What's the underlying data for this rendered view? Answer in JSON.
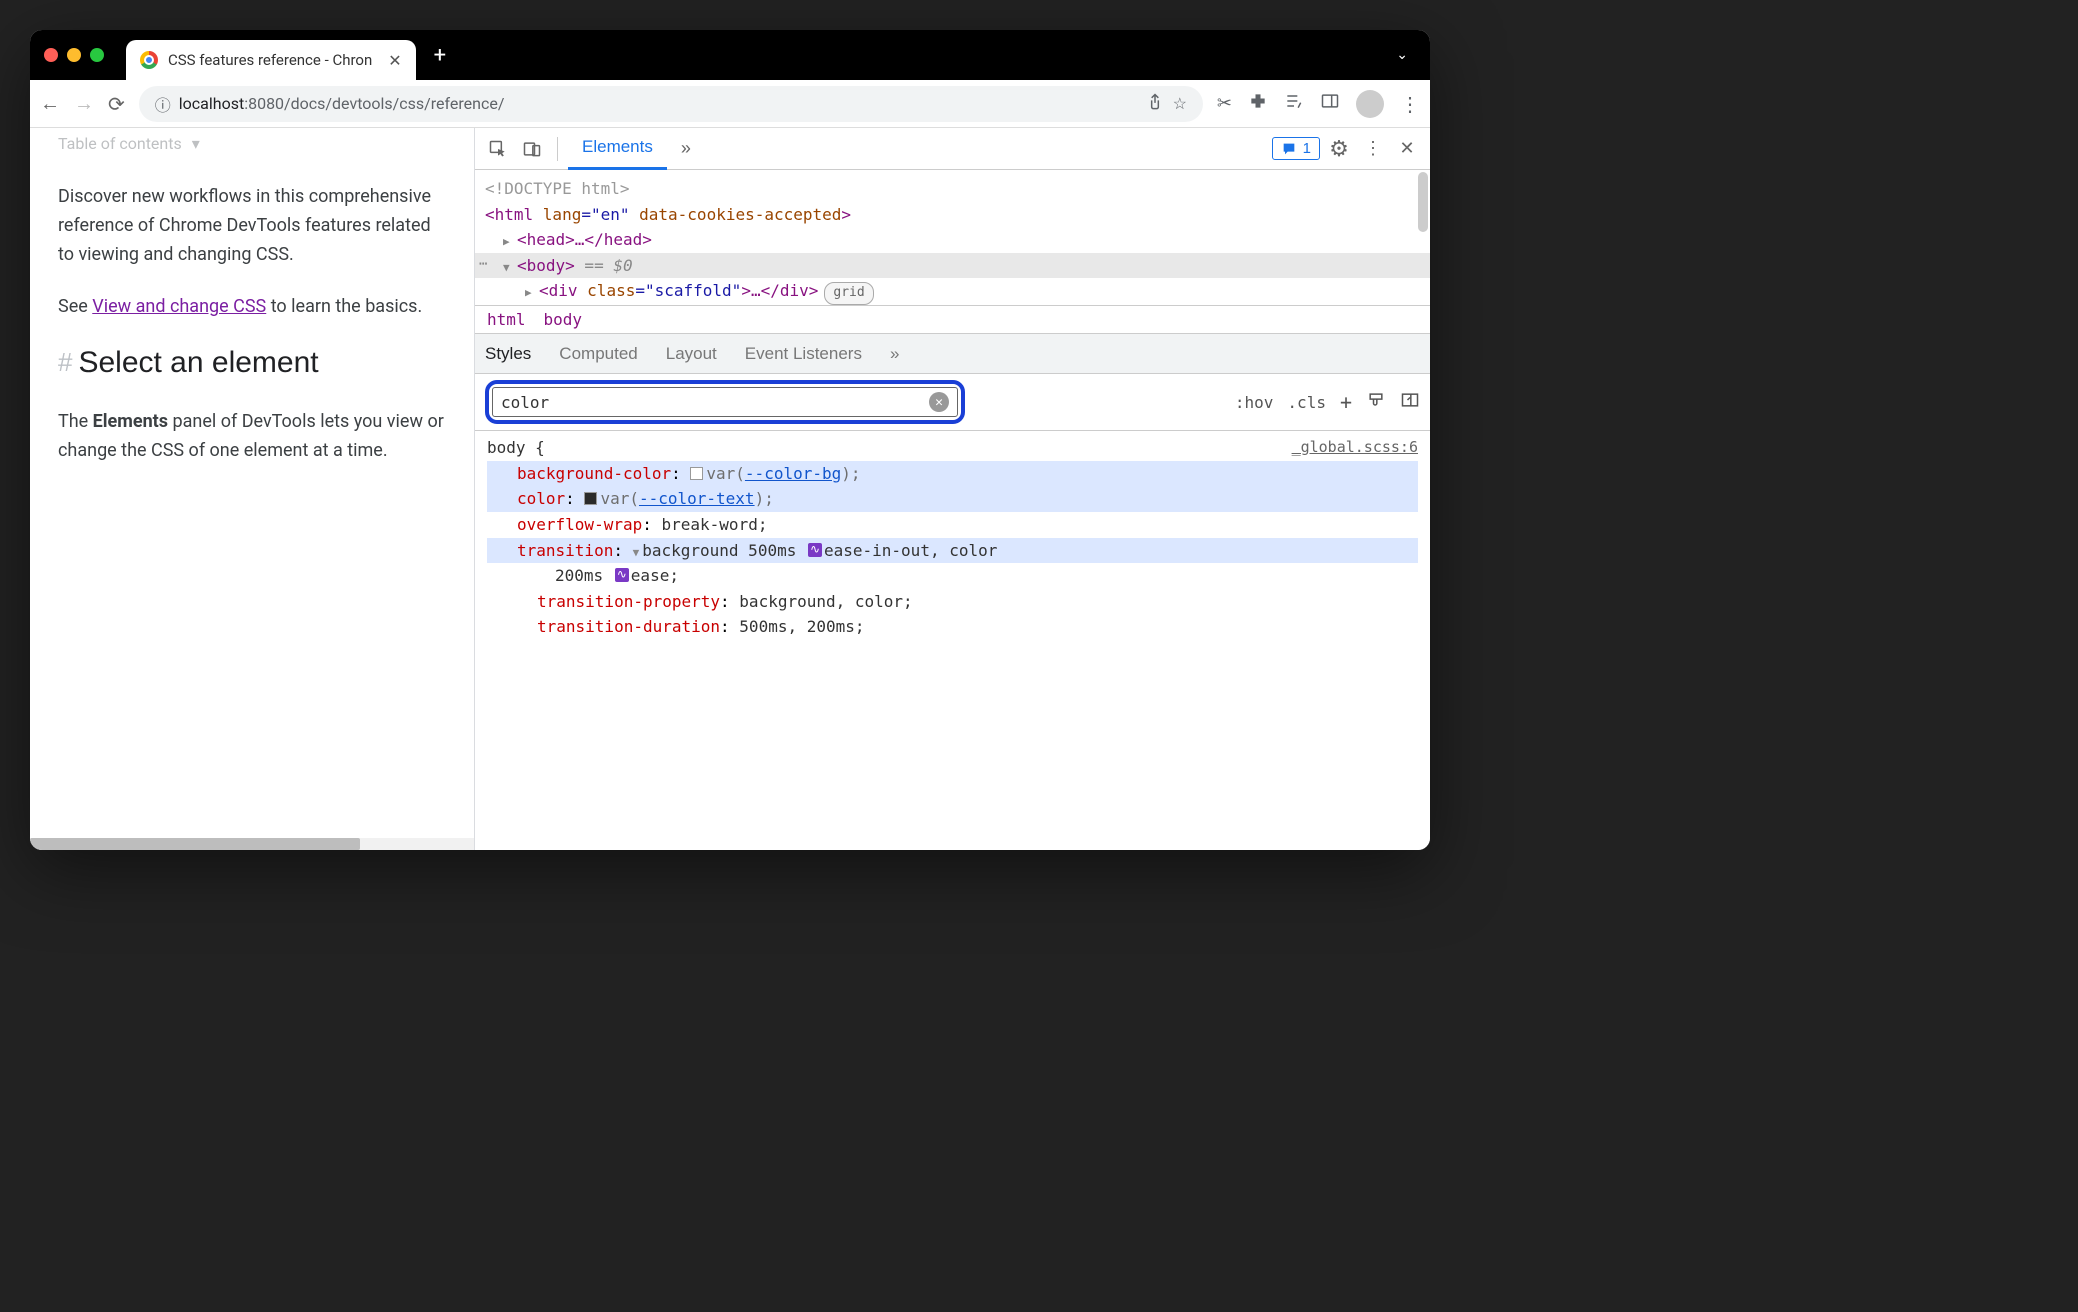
{
  "browser": {
    "tab_title": "CSS features reference - Chron",
    "url_info_icon": "ⓘ",
    "url_host": "localhost",
    "url_port": ":8080",
    "url_path": "/docs/devtools/css/reference/"
  },
  "page": {
    "toc_label": "Table of contents",
    "p1": "Discover new workflows in this comprehensive reference of Chrome DevTools features related to viewing and changing CSS.",
    "p2_a": "See ",
    "p2_link": "View and change CSS",
    "p2_b": " to learn the basics.",
    "h2": "Select an element",
    "p3_a": "The ",
    "p3_b": "Elements",
    "p3_c": " panel of DevTools lets you view or change the CSS of one element at a time."
  },
  "devtools": {
    "tab_elements": "Elements",
    "issues_count": "1",
    "dom": {
      "doctype": "<!DOCTYPE html>",
      "html_open_a": "<html ",
      "html_lang_n": "lang",
      "html_lang_v": "=\"en\"",
      "html_cookies": " data-cookies-accepted",
      "html_close": ">",
      "head": "<head>…</head>",
      "body": "<body>",
      "body_eq": " == ",
      "body_dollar": "$0",
      "div_a": "<div ",
      "div_class_n": "class",
      "div_class_v": "=\"scaffold\"",
      "div_close": ">…</div>",
      "div_badge": "grid"
    },
    "breadcrumb": {
      "html": "html",
      "body": "body"
    },
    "styles_tabs": {
      "styles": "Styles",
      "computed": "Computed",
      "layout": "Layout",
      "listeners": "Event Listeners"
    },
    "filter_value": "color",
    "actions": {
      "hov": ":hov",
      "cls": ".cls"
    },
    "rule": {
      "selector": "body {",
      "source": "_global.scss:6",
      "bg_prop": "background-color",
      "bg_val_a": "var(",
      "bg_var": "--color-bg",
      "bg_val_b": ");",
      "color_prop": "color",
      "color_val_a": "var(",
      "color_var": "--color-text",
      "color_val_b": ");",
      "ow_prop": "overflow-wrap",
      "ow_val": "break-word;",
      "tr_prop": "transition",
      "tr_val_a": "background 500ms ",
      "tr_val_b": "ease-in-out, color",
      "tr_val_c": "200ms ",
      "tr_val_d": "ease;",
      "trp_prop": "transition-property",
      "trp_val": "background, color;",
      "trd_prop": "transition-duration",
      "trd_val": "500ms, 200ms;"
    }
  }
}
